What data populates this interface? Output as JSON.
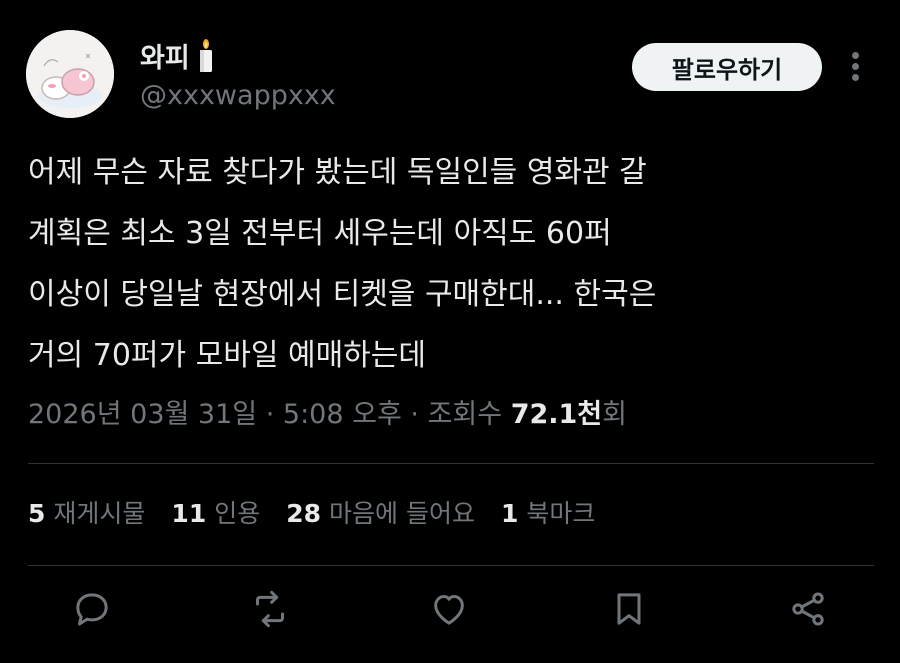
{
  "tweet": {
    "author": {
      "display_name": "와피",
      "handle": "@xxxwappxxx"
    },
    "follow_label": "팔로우하기",
    "text_lines": [
      "어제 무슨 자료 찾다가 봤는데 독일인들 영화관 갈",
      "계획은 최소 3일 전부터 세우는데 아직도 60퍼",
      "이상이 당일날 현장에서 티켓을 구매한대... 한국은",
      "거의 70퍼가 모바일 예매하는데"
    ],
    "meta": {
      "date": "2026년 03월 31일",
      "time": "5:08 오후",
      "views_label": "조회수",
      "views_value": "72.1천",
      "views_suffix": "회"
    },
    "stats": {
      "reposts": {
        "count": "5",
        "label": "재게시물"
      },
      "quotes": {
        "count": "11",
        "label": "인용"
      },
      "likes": {
        "count": "28",
        "label": "마음에 들어요"
      },
      "bookmarks": {
        "count": "1",
        "label": "북마크"
      }
    },
    "actions": [
      "reply-icon",
      "repost-icon",
      "like-icon",
      "bookmark-icon",
      "share-icon"
    ]
  },
  "colors": {
    "background": "#000000",
    "text_primary": "#e7e9ea",
    "text_secondary": "#71767b",
    "divider": "#2f3336",
    "follow_button_bg": "#eff3f4"
  }
}
